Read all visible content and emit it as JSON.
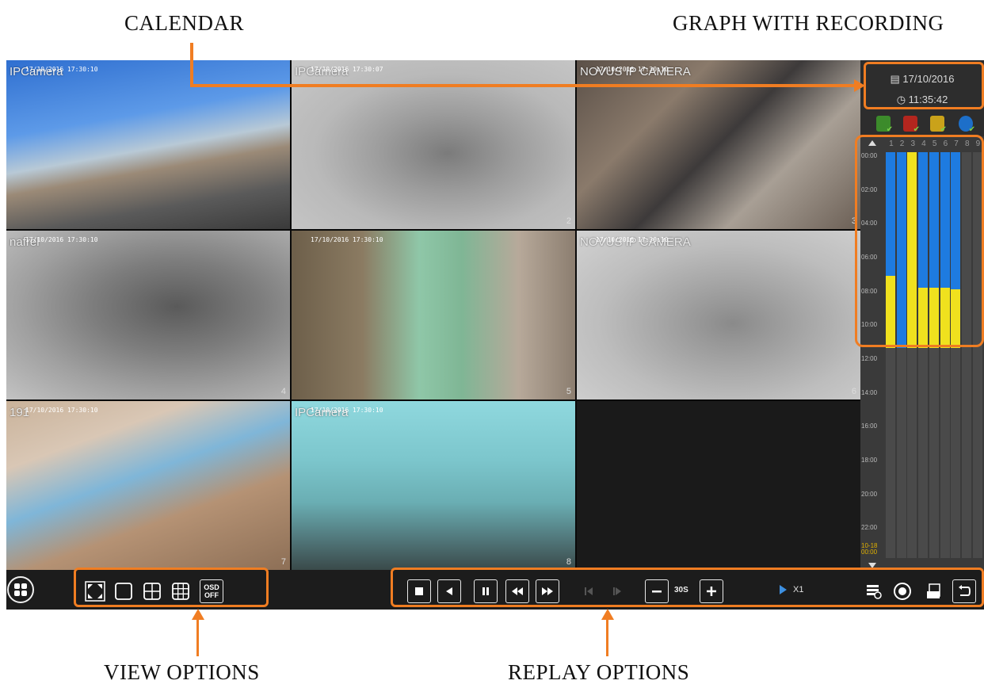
{
  "annotations": {
    "calendar": "CALENDAR",
    "graph": "GRAPH WITH RECORDING",
    "view_options": "VIEW OPTIONS",
    "replay_options": "REPLAY OPTIONS"
  },
  "cameras": [
    {
      "name": "IPCamera",
      "timestamp": "17/10/2016 17:30:10",
      "number": ""
    },
    {
      "name": "IPCamera",
      "timestamp": "17/10/2016 17:30:07",
      "number": "2"
    },
    {
      "name": "NOVUS IP CAMERA",
      "timestamp": "17/10/2016 17:30:10",
      "number": "3"
    },
    {
      "name": "nafrel",
      "timestamp": "17/10/2016 17:30:10",
      "number": "4"
    },
    {
      "name": "",
      "timestamp": "17/10/2016 17:30:10",
      "number": "5"
    },
    {
      "name": "NOVUS IP CAMERA",
      "timestamp": "17/10/2016 17:30:10",
      "number": "6"
    },
    {
      "name": "191",
      "timestamp": "17/10/2016 17:30:10",
      "number": "7"
    },
    {
      "name": "IPCamera",
      "timestamp": "17/10/2016 17:30:10",
      "number": "8"
    },
    {
      "name": "",
      "timestamp": "",
      "number": ""
    }
  ],
  "calendar": {
    "date": "17/10/2016",
    "time": "11:35:42"
  },
  "record_types": [
    {
      "icon": "manual-record-icon",
      "color": "#3c8b2b"
    },
    {
      "icon": "alarm-record-icon",
      "color": "#b3261e"
    },
    {
      "icon": "motion-record-icon",
      "color": "#caa21a"
    },
    {
      "icon": "schedule-record-icon",
      "color": "#1d6fc9"
    }
  ],
  "timeline": {
    "channels": [
      "1",
      "2",
      "3",
      "4",
      "5",
      "6",
      "7",
      "8",
      "9"
    ],
    "hour_labels": [
      "00:00",
      "02:00",
      "04:00",
      "06:00",
      "08:00",
      "10:00",
      "12:00",
      "14:00",
      "16:00",
      "18:00",
      "20:00",
      "22:00"
    ],
    "end_label_date": "10-18",
    "end_label_time": "00:00",
    "colors": {
      "continuous": "#1e7be0",
      "motion": "#f0e11e"
    }
  },
  "controls": {
    "step": "30S",
    "speed": "X1",
    "osd_line1": "OSD",
    "osd_line2": "OFF"
  }
}
